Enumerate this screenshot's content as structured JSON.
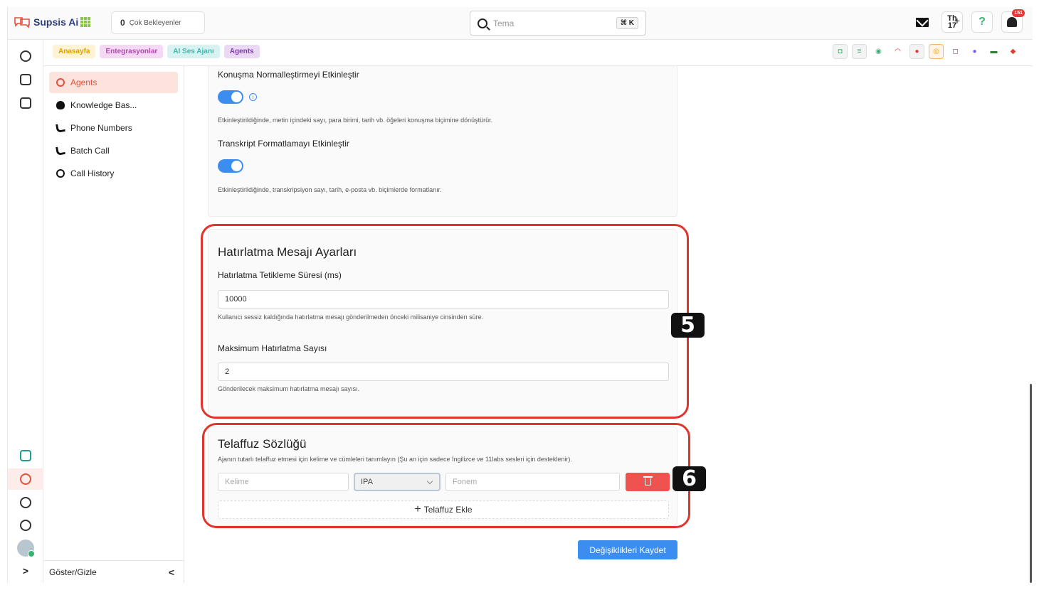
{
  "app": {
    "name": "Supsis Ai"
  },
  "header": {
    "waiting_count": "0",
    "waiting_label": "Çok Bekleyenler",
    "search_placeholder": "Tema",
    "search_shortcut": "⌘ K",
    "calendar_day": "Th",
    "calendar_date": "17",
    "notification_count": "151"
  },
  "breadcrumbs": [
    {
      "label": "Anasayfa",
      "color": "#e0a000"
    },
    {
      "label": "Entegrasyonlar",
      "color": "#b24ab0"
    },
    {
      "label": "AI Ses Ajanı",
      "color": "#3fb8b0"
    },
    {
      "label": "Agents",
      "color": "#7b3fa6"
    }
  ],
  "channels": [
    "bot-icon",
    "list-icon",
    "voice-agent-icon",
    "wifi-icon",
    "telegram-icon",
    "whatsapp-icon",
    "instagram-icon",
    "messenger-icon",
    "sms-icon",
    "supsis-icon"
  ],
  "subnav": {
    "items": [
      {
        "label": "Agents",
        "icon": "agent-icon",
        "active": true
      },
      {
        "label": "Knowledge Bas...",
        "icon": "bulb-icon"
      },
      {
        "label": "Phone Numbers",
        "icon": "phone-icon"
      },
      {
        "label": "Batch Call",
        "icon": "phone-icon"
      },
      {
        "label": "Call History",
        "icon": "history-icon"
      }
    ],
    "footer_label": "Göster/Gizle"
  },
  "settings": {
    "speech_normalization": {
      "label": "Konuşma Normalleştirmeyi Etkinleştir",
      "enabled": true,
      "help": "Etkinleştirildiğinde, metin içindeki sayı, para birimi, tarih vb. öğeleri konuşma biçimine dönüştürür."
    },
    "transcript_formatting": {
      "label": "Transkript Formatlamayı Etkinleştir",
      "enabled": true,
      "help": "Etkinleştirildiğinde, transkripsiyon sayı, tarih, e-posta vb. biçimlerde formatlanır."
    }
  },
  "reminder": {
    "title": "Hatırlatma Mesajı Ayarları",
    "trigger_label": "Hatırlatma Tetikleme Süresi (ms)",
    "trigger_value": "10000",
    "trigger_help": "Kullanıcı sessiz kaldığında hatırlatma mesajı gönderilmeden önceki milisaniye cinsinden süre.",
    "max_label": "Maksimum Hatırlatma Sayısı",
    "max_value": "2",
    "max_help": "Gönderilecek maksimum hatırlatma mesajı sayısı.",
    "annotation": "5"
  },
  "pronunciation": {
    "title": "Telaffuz Sözlüğü",
    "description": "Ajanın tutarlı telaffuz etmesi için kelime ve cümleleri tanımlayın (Şu an için sadece İngilizce ve 11labs sesleri için desteklenir).",
    "word_placeholder": "Kelime",
    "alphabet_selected": "IPA",
    "phoneme_placeholder": "Fonem",
    "add_label": "Telaffuz Ekle",
    "annotation": "6"
  },
  "save_label": "Değişiklikleri Kaydet"
}
